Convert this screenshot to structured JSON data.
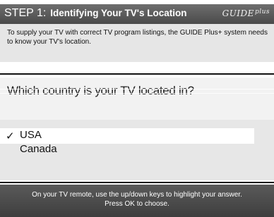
{
  "header": {
    "step": "STEP 1:",
    "title": "Identifying Your TV's Location",
    "logo_text": "GUIDE",
    "logo_plus": "plus"
  },
  "intro": {
    "text": "To supply your TV with correct TV program listings, the GUIDE Plus+ system needs to know your TV's location."
  },
  "question": {
    "text": "Which country is your TV located in?"
  },
  "options": [
    {
      "label": "USA",
      "selected": true,
      "check": "✓"
    },
    {
      "label": "Canada",
      "selected": false,
      "check": ""
    }
  ],
  "footer": {
    "line1": "On your TV remote, use the up/down keys to highlight your answer.",
    "line2": "Press OK to choose."
  },
  "colors": {
    "title_bar": "#555555",
    "intro_bg": "#e6e6e6",
    "question_bg": "#f2f2f2",
    "options_bg": "#e7e7e7",
    "highlight": "#ffffff",
    "footer_bg": "#4a4a4a"
  }
}
